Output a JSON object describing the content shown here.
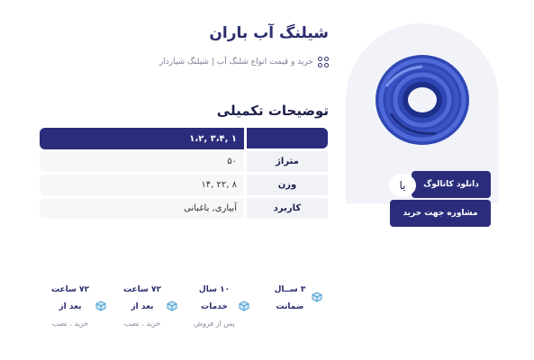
{
  "product": {
    "title": "شیلنگ آب باران",
    "breadcrumb": "خرید و قیمت انواع شلنگ آب | شیلنگ شیاردار",
    "image_icon": "blue-hose-coil-image"
  },
  "specs": {
    "section_title": "توضیحات تکمیلی",
    "header_value": "۱ ,۳،۴ ,۱،۲",
    "rows": [
      {
        "key": "متراژ",
        "value": "۵۰"
      },
      {
        "key": "وزن",
        "value": "۸ ,۲۲ ,۱۴"
      },
      {
        "key": "کاربرد",
        "value": "آبیاری, باغبانی"
      }
    ]
  },
  "actions": {
    "catalog_label": "دانلود کاتالوگ",
    "or_label": "یا",
    "consult_label": "مشاوره جهت خرید"
  },
  "features": [
    {
      "title": "۳ ســال",
      "sub": "ضمانت",
      "note": ""
    },
    {
      "title": "۱۰ سال",
      "sub": "خدمات",
      "note": "پس از فروش"
    },
    {
      "title": "۷۲ ساعت",
      "sub": "بعد از",
      "note": "خرید ، نصب"
    },
    {
      "title": "۷۲ ساعت",
      "sub": "بعد از",
      "note": "خرید ، نصب"
    }
  ],
  "colors": {
    "primary": "#2b2d7c",
    "card_bg": "#f1f3f8",
    "hose": "#3d57c8"
  },
  "icons": [
    "grid-dots-icon",
    "cube-icon"
  ]
}
